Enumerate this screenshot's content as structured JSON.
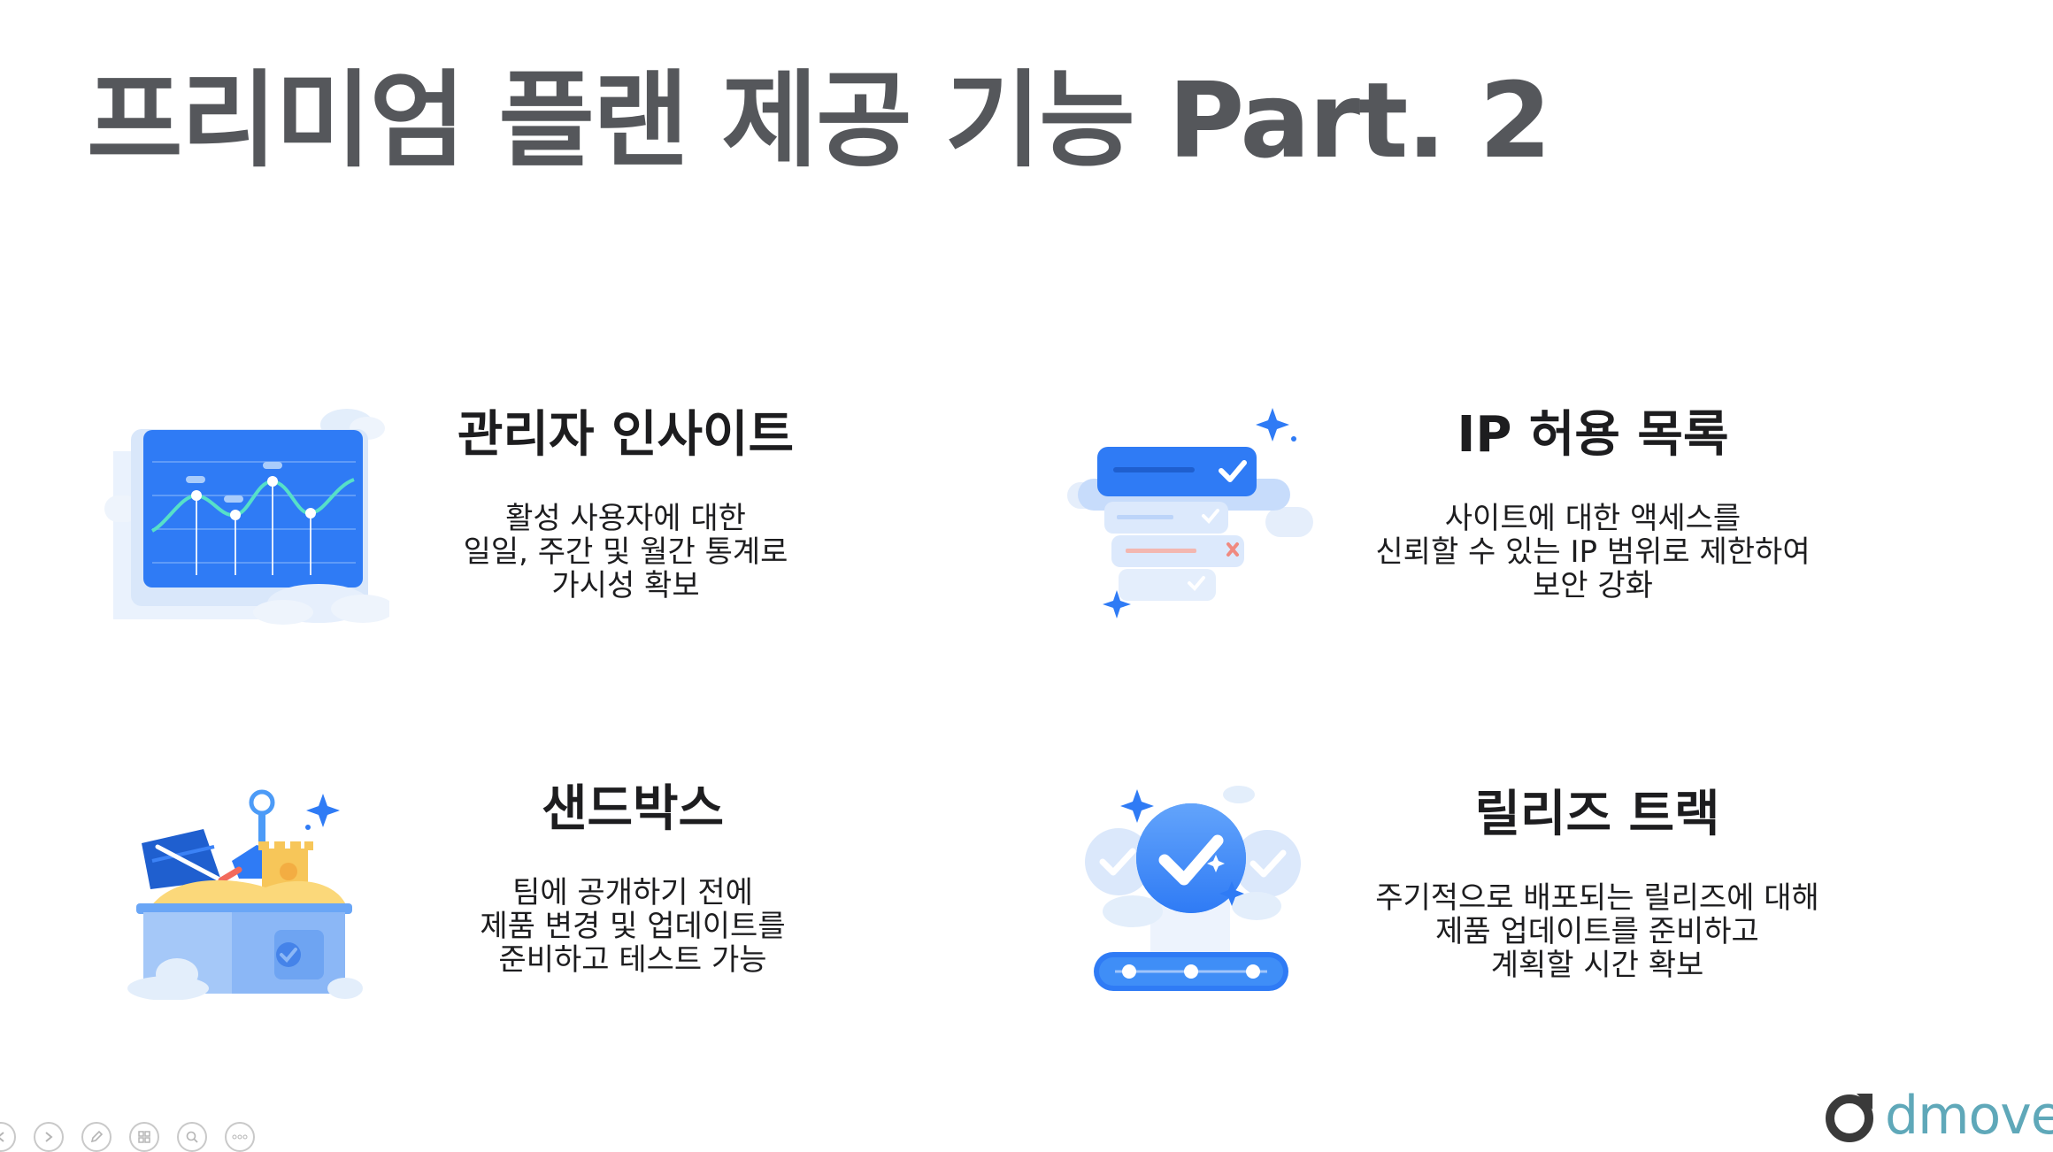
{
  "title": "프리미엄 플랜 제공 기능 Part. 2",
  "features": [
    {
      "heading": "관리자 인사이트",
      "lines": [
        "활성 사용자에 대한",
        "일일, 주간 및 월간 통계로",
        "가시성 확보"
      ],
      "icon": "chart-icon"
    },
    {
      "heading": "IP 허용 목록",
      "lines": [
        "사이트에 대한 액세스를",
        "신뢰할 수 있는 IP 범위로 제한하여",
        "보안 강화"
      ],
      "icon": "checklist-icon"
    },
    {
      "heading": "샌드박스",
      "lines": [
        "팀에 공개하기 전에",
        "제품 변경 및 업데이트를",
        "준비하고 테스트 가능"
      ],
      "icon": "sandbox-icon"
    },
    {
      "heading": "릴리즈 트랙",
      "lines": [
        "주기적으로 배포되는 릴리즈에 대해",
        "제품 업데이트를 준비하고",
        "계획할 시간 확보"
      ],
      "icon": "release-track-icon"
    }
  ],
  "logo": {
    "text": "dmove",
    "color": "#5fa8b9"
  },
  "toolbar": [
    "prev-icon",
    "next-icon",
    "pen-icon",
    "grid-icon",
    "zoom-icon",
    "more-icon"
  ]
}
